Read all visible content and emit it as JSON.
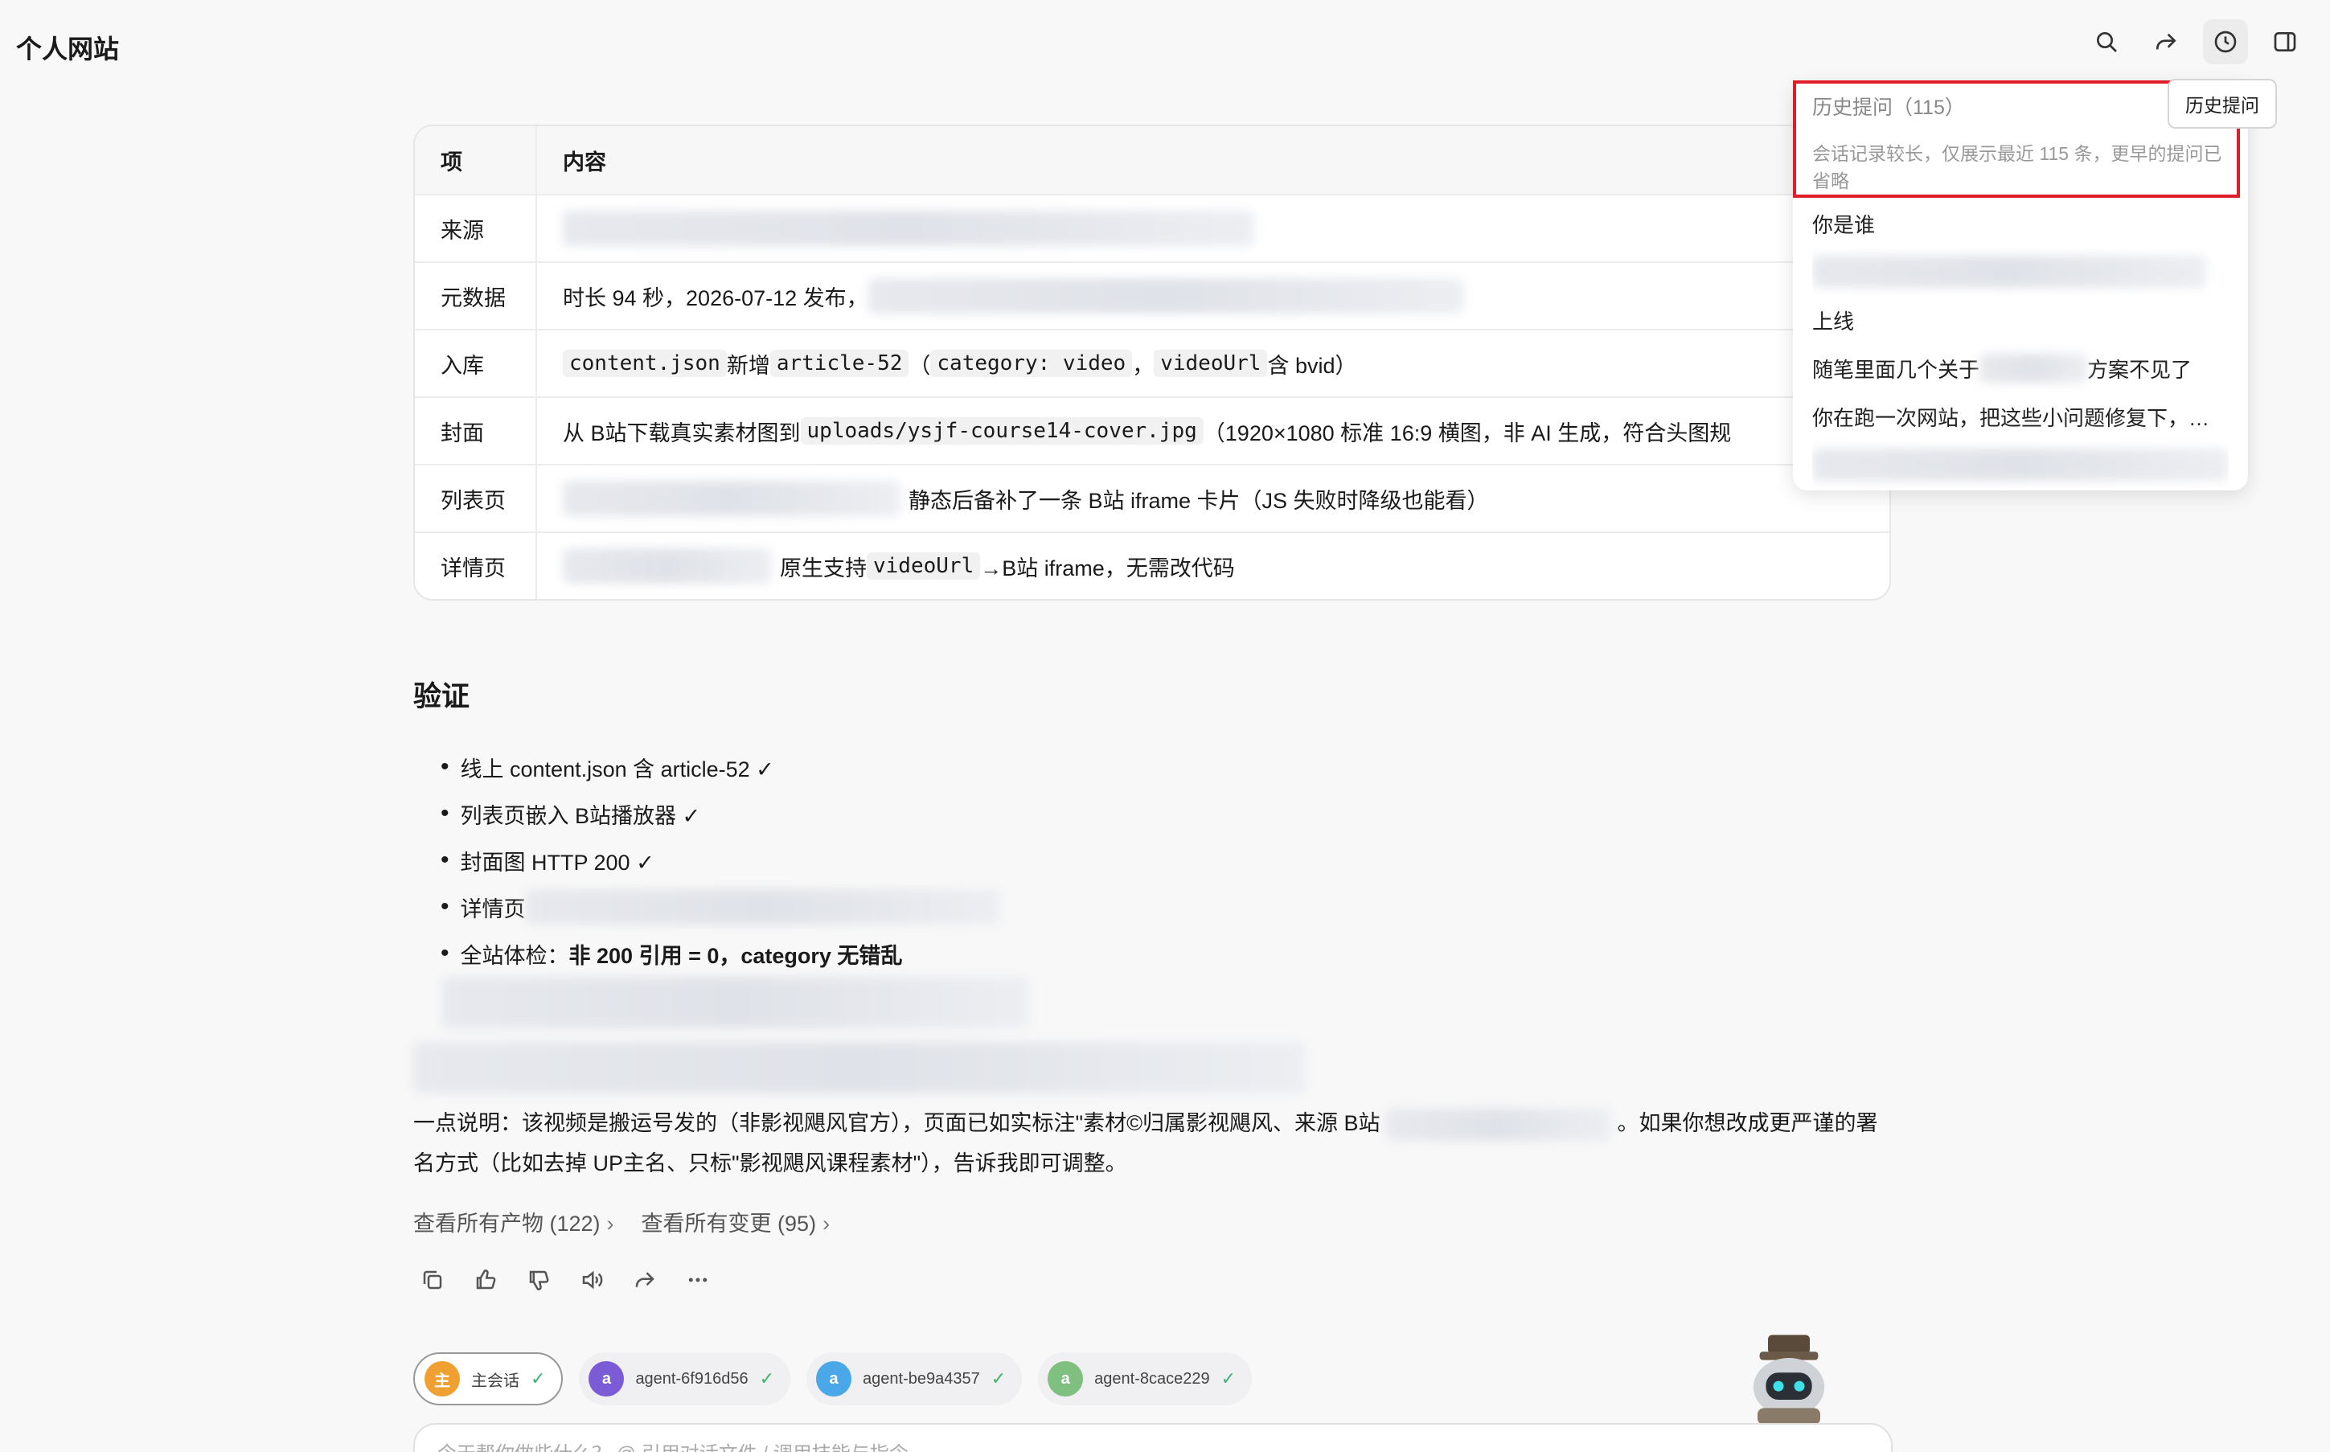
{
  "app": {
    "title": "个人网站"
  },
  "toolbar": {
    "icons": [
      "search-icon",
      "share-icon",
      "history-icon",
      "sidebar-icon"
    ]
  },
  "table": {
    "headers": [
      "项",
      "内容"
    ],
    "rows": [
      {
        "key": "来源",
        "prefix": "",
        "suffix": ""
      },
      {
        "key": "元数据",
        "prefix": "时长 94 秒，2026-07-12 发布，",
        "suffix": ""
      },
      {
        "key": "入库",
        "code1": "content.json",
        "mid1": " 新增 ",
        "code2": "article-52",
        "mid2": "（",
        "code3": "category: video",
        "mid3": "，",
        "code4": "videoUrl",
        "end": " 含 bvid）"
      },
      {
        "key": "封面",
        "pre": "从 B站下载真实素材图到 ",
        "code": "uploads/ysjf-course14-cover.jpg",
        "post": "（1920×1080 标准 16:9 横图，非 AI 生成，符合头图规"
      },
      {
        "key": "列表页",
        "text": "静态后备补了一条 B站 iframe 卡片（JS 失败时降级也能看）"
      },
      {
        "key": "详情页",
        "pre": "原生支持 ",
        "code": "videoUrl",
        "post": " →B站 iframe，无需改代码"
      }
    ]
  },
  "verify": {
    "title": "验证",
    "items": [
      "线上 content.json 含 article-52 ✓",
      "列表页嵌入 B站播放器 ✓",
      "封面图 HTTP 200 ✓",
      "详情页"
    ],
    "last_prefix": "全站体检：",
    "last_bold": "非 200 引用 = 0，category 无错乱"
  },
  "note": {
    "part1": "一点说明：该视频是搬运号发的（非影视飓风官方），页面已如实标注\"素材©归属影视飓风、来源 B站",
    "part2": "。如果你想改成更严谨的署名方式（比如去掉 UP主名、只标\"影视飓风课程素材\"），告诉我即可调整。"
  },
  "links": {
    "artifacts": "查看所有产物 (122)",
    "changes": "查看所有变更 (95)"
  },
  "agents": [
    {
      "badge": "主",
      "name": "主会话",
      "color": "#f0a030"
    },
    {
      "badge": "a",
      "name": "agent-6f916d56",
      "color": "#7b5cd6"
    },
    {
      "badge": "a",
      "name": "agent-be9a4357",
      "color": "#4aa8e8"
    },
    {
      "badge": "a",
      "name": "agent-8cace229",
      "color": "#7fbf7f"
    }
  ],
  "input": {
    "placeholder": "今天帮你做些什么？  @ 引用对话文件  / 调用技能与指令"
  },
  "history": {
    "title": "历史提问（115）",
    "desc": "会话记录较长，仅展示最近 115 条，更早的提问已省略",
    "items": [
      "你是谁",
      "上线",
      "随笔里面几个关于",
      "方案不见了",
      "你在跑一次网站，把这些小问题修复下，…"
    ],
    "tooltip": "历史提问"
  }
}
